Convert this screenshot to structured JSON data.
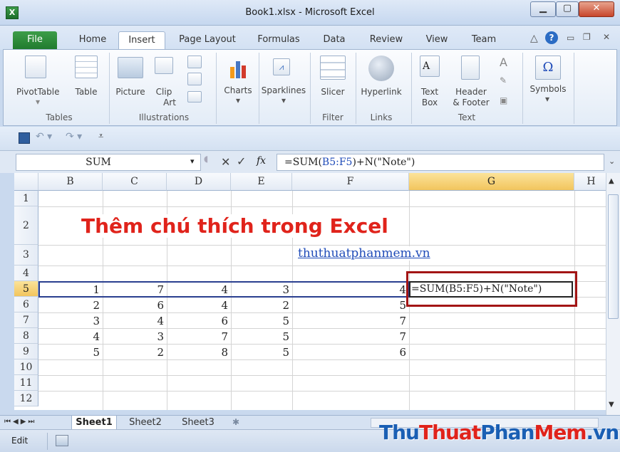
{
  "window": {
    "title": "Book1.xlsx - Microsoft Excel",
    "app_icon": "X"
  },
  "tabs": [
    "File",
    "Home",
    "Insert",
    "Page Layout",
    "Formulas",
    "Data",
    "Review",
    "View",
    "Team"
  ],
  "ribbon": {
    "groups": [
      {
        "label": "Tables",
        "items": [
          "PivotTable",
          "Table"
        ]
      },
      {
        "label": "Illustrations",
        "items": [
          "Picture",
          "Clip Art"
        ]
      },
      {
        "label": "",
        "items": [
          "Charts"
        ]
      },
      {
        "label": "",
        "items": [
          "Sparklines"
        ]
      },
      {
        "label": "Filter",
        "items": [
          "Slicer"
        ]
      },
      {
        "label": "Links",
        "items": [
          "Hyperlink"
        ]
      },
      {
        "label": "Text",
        "items": [
          "Text Box",
          "Header & Footer"
        ]
      },
      {
        "label": "",
        "items": [
          "Symbols"
        ]
      }
    ],
    "labels": {
      "pivot1": "PivotTable",
      "table": "Table",
      "picture": "Picture",
      "clip1": "Clip",
      "clip2": "Art",
      "charts": "Charts",
      "sparklines": "Sparklines",
      "slicer": "Slicer",
      "hyperlink": "Hyperlink",
      "textbox1": "Text",
      "textbox2": "Box",
      "hf1": "Header",
      "hf2": "& Footer",
      "symbols": "Symbols",
      "tables": "Tables",
      "illustrations": "Illustrations",
      "filter": "Filter",
      "links": "Links",
      "text": "Text"
    }
  },
  "formula_bar": {
    "name_box": "SUM",
    "fx": "fx",
    "formula_pre": "=SUM(",
    "formula_ref": "B5:F5",
    "formula_post": ")+N(\"Note\")"
  },
  "grid": {
    "columns": [
      "B",
      "C",
      "D",
      "E",
      "F",
      "G",
      "H"
    ],
    "rows": [
      "1",
      "2",
      "3",
      "4",
      "5",
      "6",
      "7",
      "8",
      "9",
      "10",
      "11",
      "12"
    ],
    "title_text": "Thêm chú thích trong Excel",
    "link_text": "thuthuatphanmem.vn",
    "data": [
      [
        "1",
        "7",
        "4",
        "3",
        "4"
      ],
      [
        "2",
        "6",
        "4",
        "2",
        "5"
      ],
      [
        "3",
        "4",
        "6",
        "5",
        "7"
      ],
      [
        "4",
        "3",
        "7",
        "5",
        "7"
      ],
      [
        "5",
        "2",
        "8",
        "5",
        "6"
      ]
    ],
    "edit_cell": "=SUM(B5:F5)+N(\"Note\")"
  },
  "sheets": [
    "Sheet1",
    "Sheet2",
    "Sheet3"
  ],
  "status": {
    "mode": "Edit"
  },
  "watermark": {
    "part1": "Thu",
    "part2": "Thuat",
    "part3": "Phan",
    "part4": "Mem",
    "part5": ".vn"
  },
  "colors": {
    "accent_red": "#e0231b",
    "highlight": "#f2c55d",
    "link": "#1f4bb8",
    "box": "#a31515"
  }
}
